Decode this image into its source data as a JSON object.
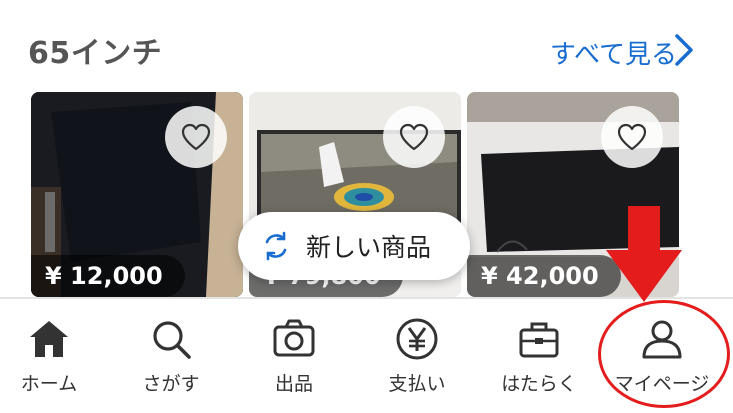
{
  "section": {
    "title": "65インチ",
    "see_all": "すべて見る"
  },
  "items": [
    {
      "price": "¥ 12,000",
      "icon": "heart-icon"
    },
    {
      "price": "¥ 79,800",
      "icon": "heart-icon"
    },
    {
      "price": "¥ 42,000",
      "icon": "heart-icon"
    }
  ],
  "new_items_button": {
    "label": "新しい商品",
    "icon": "refresh-icon"
  },
  "tabbar": {
    "tabs": [
      {
        "label": "ホーム",
        "icon": "home-icon"
      },
      {
        "label": "さがす",
        "icon": "search-icon"
      },
      {
        "label": "出品",
        "icon": "camera-icon"
      },
      {
        "label": "支払い",
        "icon": "yen-icon"
      },
      {
        "label": "はたらく",
        "icon": "briefcase-icon"
      },
      {
        "label": "マイページ",
        "icon": "user-icon"
      }
    ]
  },
  "colors": {
    "accent": "#1a6dd0",
    "annotation": "#e41c1c",
    "title": "#555555"
  }
}
